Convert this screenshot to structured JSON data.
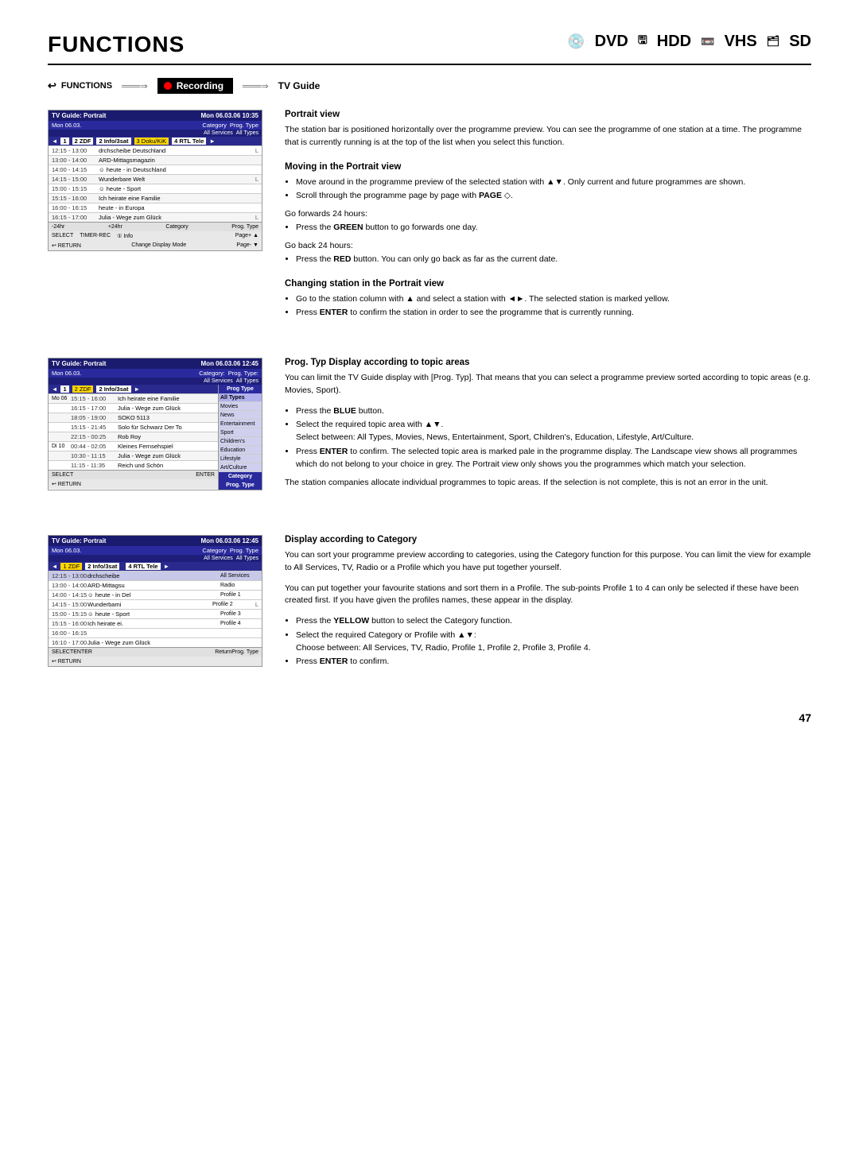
{
  "header": {
    "title": "FUNCTIONS",
    "media": {
      "dvd": "DVD",
      "hdd": "HDD",
      "vhs": "VHS",
      "sd": "SD"
    }
  },
  "nav": {
    "functions_label": "FUNCTIONS",
    "recording_label": "Recording",
    "tv_guide_label": "TV Guide"
  },
  "portrait_section": {
    "title": "Portrait view",
    "body1": "The station bar is positioned horizontally over the programme preview. You can see the programme of one station at a time. The programme that is currently running is at the top of the list when you select this function.",
    "moving_title": "Moving in the Portrait view",
    "bullet1": "Move around in the programme preview of the selected station with ▲▼. Only current and future programmes are shown.",
    "bullet2": "Scroll through the programme page by page with PAGE ◇.",
    "go_forward": "Go forwards 24 hours:",
    "green_btn": "Press the GREEN button to go forwards one day.",
    "go_back": "Go back 24 hours:",
    "red_btn": "Press the RED button. You can only go back as far as the current date.",
    "changing_title": "Changing station in the Portrait view",
    "ch_bullet1": "Go to the station column with ▲ and select a station with ◄►. The selected station is marked yellow.",
    "ch_bullet2": "Press ENTER to confirm the station in order to see the programme that is currently running."
  },
  "prog_typ_section": {
    "title": "Prog. Typ  Display according to topic areas",
    "body1": "You can limit the TV Guide display with [Prog. Typ]. That means that you can select a programme preview sorted according to topic areas (e.g. Movies, Sport).",
    "bullet1": "Press the BLUE button.",
    "bullet2": "Select the required topic area with ▲▼.\n        Select between: All Types, Movies, News, Entertainment, Sport, Children's, Education, Lifestyle, Art/Culture.",
    "bullet3": "Press ENTER to confirm. The selected topic area is marked pale in the programme display. The Landscape view shows all programmes which do not belong to your choice in grey. The Portrait view only shows you the programmes which match your selection.",
    "footer": "The station companies allocate individual programmes to topic areas. If the selection is not complete, this is not an error in the unit."
  },
  "category_section": {
    "title": "Display according to Category",
    "body1": "You can sort your programme preview according to categories, using the Category function for this purpose. You can limit the view for example to All Services, TV, Radio or a Profile which you have put together yourself.",
    "body2": "You can put together your favourite stations and sort them in a Profile. The sub-points Profile 1 to 4 can only be selected if these have been created first. If you have given the profiles names, these appear in the display.",
    "bullet1": "Press the YELLOW button to select the Category function.",
    "bullet2": "Select the required Category or Profile with ▲▼:\n        Choose between: All Services, TV, Radio, Profile 1, Profile 2, Profile 3, Profile 4.",
    "bullet3": "Press ENTER to confirm."
  },
  "tv_guide1": {
    "header_left": "TV Guide: Portrait",
    "header_right": "Mon 06.03.06 10:35",
    "date": "Mon 06.03.",
    "category_label": "Category",
    "category_val": "All Services",
    "prog_type_label": "Prog. Type",
    "prog_type_val": "All Types",
    "channels": [
      "1",
      "2 ZDF",
      "2 Info/3sat",
      "3 Doku/KiK",
      "4 RTL Tele"
    ],
    "rows": [
      {
        "time": "12:15 - 13:00",
        "prog": "drchscheibe Deutschland",
        "icon": "L"
      },
      {
        "time": "13:00 - 14:00",
        "prog": "ARD-Mittagsmagazin",
        "icon": ""
      },
      {
        "time": "14:00 - 14:15",
        "prog": "☺ heute - in Deutschland",
        "icon": ""
      },
      {
        "time": "14:15 - 15:00",
        "prog": "Wunderbare Welt",
        "icon": "L"
      },
      {
        "time": "15:00 - 15:15",
        "prog": "☺ heute - Sport",
        "icon": ""
      },
      {
        "time": "15:15 - 16:00",
        "prog": "Ich heirate eine Familie",
        "icon": ""
      },
      {
        "time": "16:00 - 16:15",
        "prog": "heute - in Europa",
        "icon": ""
      },
      {
        "time": "16:15 - 17:00",
        "prog": "Julia - Wege zum Glück",
        "icon": "L"
      }
    ],
    "footer_buttons": "SELECT TIMER-REC ① Info RETURN Change Display Mode",
    "footer_pages": "Page+ / Page-"
  },
  "tv_guide2": {
    "header_left": "TV Guide: Portrait",
    "header_right": "Mon 06.03.06 12:45",
    "date": "Mon 06.03.",
    "rows_main": [
      {
        "day": "Mo 06",
        "time": "15:15 - 16:00",
        "prog": "Ich heirate eine Familie"
      },
      {
        "day": "",
        "time": "16:15 - 17:00",
        "prog": "Julia - Wege zum Glück"
      },
      {
        "day": "",
        "time": "18:05 - 19:00",
        "prog": "SOKO 5113"
      },
      {
        "day": "",
        "time": "15:15 - 21:45",
        "prog": "Solo für Schwarz Der To"
      },
      {
        "day": "",
        "time": "22:15 - 00:25",
        "prog": "Rob Roy"
      },
      {
        "day": "Di 10",
        "time": "00:44 - 02:05",
        "prog": "Kleines Fernsehspiel"
      },
      {
        "day": "",
        "time": "10:30 - 11:15",
        "prog": "Julia - Wege zum Glück"
      },
      {
        "day": "",
        "time": "11:15 - 11:35",
        "prog": "Reich und Schön"
      }
    ],
    "side_items": [
      "All Types",
      "Movies",
      "News",
      "Entertainment",
      "Sport",
      "Children's",
      "Education",
      "Lifestyle",
      "Art/Culture",
      "Category",
      "Prog. Type"
    ]
  },
  "tv_guide3": {
    "header_left": "TV Guide: Portrait",
    "header_right": "Mon 06.03.06 12:45",
    "date": "Mon 06.03.",
    "header_cats": [
      "Category: All Services",
      "Prog. Type: All Types"
    ],
    "channels": [
      "1 ZDF",
      "2 Info/3sat",
      "4 RTL Tele"
    ],
    "rows": [
      {
        "time": "12:15 - 13:00",
        "prog": "drchscheibe",
        "cat": "All Services",
        "icon": ""
      },
      {
        "time": "13:00 - 14:00",
        "prog": "ARD-Mittagsu",
        "cat": "Radio",
        "icon": ""
      },
      {
        "time": "14:00 - 14:15",
        "prog": "☺ heute - in Del",
        "cat": "Profile 1",
        "icon": ""
      },
      {
        "time": "14:15 - 15:00",
        "prog": "Wunderbami",
        "cat": "Profile 2",
        "icon": "L"
      },
      {
        "time": "15:00 - 15:15",
        "prog": "☺ heute - Sport",
        "cat": "Profile 3",
        "icon": ""
      },
      {
        "time": "15:15 - 16:00",
        "prog": "Ich heirate ei.",
        "cat": "Profile 4",
        "icon": ""
      },
      {
        "time": "16:00 - 16:15",
        "prog": "",
        "cat": "",
        "icon": ""
      },
      {
        "time": "16:10 - 17:00",
        "prog": "Julia - Wege zum Glück",
        "cat": "",
        "icon": ""
      }
    ],
    "footer_right": [
      "Return",
      "Prog. Type"
    ]
  },
  "page_number": "47"
}
